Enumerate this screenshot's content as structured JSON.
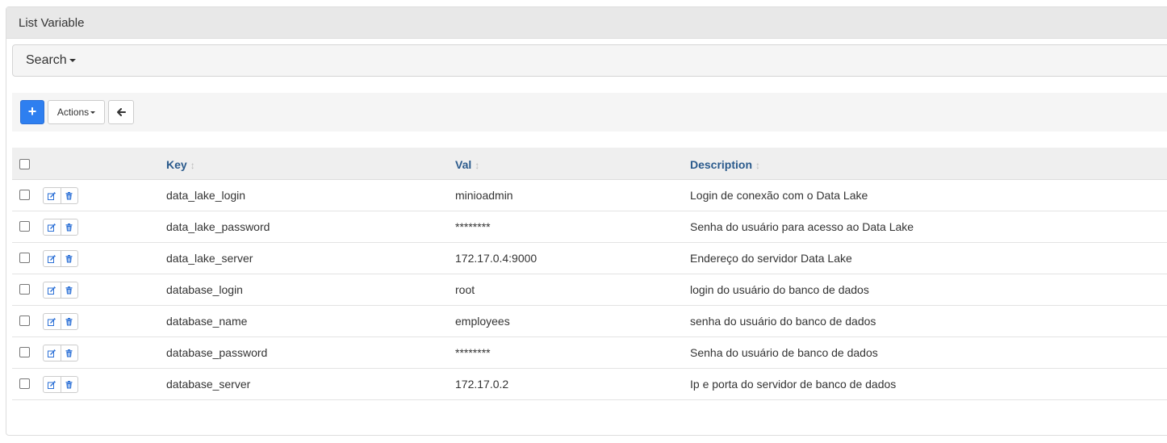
{
  "panel": {
    "title": "List Variable"
  },
  "search": {
    "label": "Search"
  },
  "toolbar": {
    "add_label": "+",
    "actions_label": "Actions",
    "back_icon": "arrow-left-icon"
  },
  "table": {
    "columns": {
      "key": "Key",
      "val": "Val",
      "description": "Description"
    },
    "rows": [
      {
        "key": "data_lake_login",
        "val": "minioadmin",
        "description": "Login de conexão com o Data Lake"
      },
      {
        "key": "data_lake_password",
        "val": "********",
        "description": "Senha do usuário para acesso ao Data Lake"
      },
      {
        "key": "data_lake_server",
        "val": "172.17.0.4:9000",
        "description": "Endereço do servidor Data Lake"
      },
      {
        "key": "database_login",
        "val": "root",
        "description": "login do usuário do banco de dados"
      },
      {
        "key": "database_name",
        "val": "employees",
        "description": "senha do usuário do banco de dados"
      },
      {
        "key": "database_password",
        "val": "********",
        "description": "Senha do usuário de banco de dados"
      },
      {
        "key": "database_server",
        "val": "172.17.0.2",
        "description": "Ip e porta do servidor de banco de dados"
      }
    ]
  },
  "colors": {
    "primary": "#2e7ff0",
    "header_link": "#2a5a8c",
    "panel_heading_bg": "#e8e8e8"
  }
}
